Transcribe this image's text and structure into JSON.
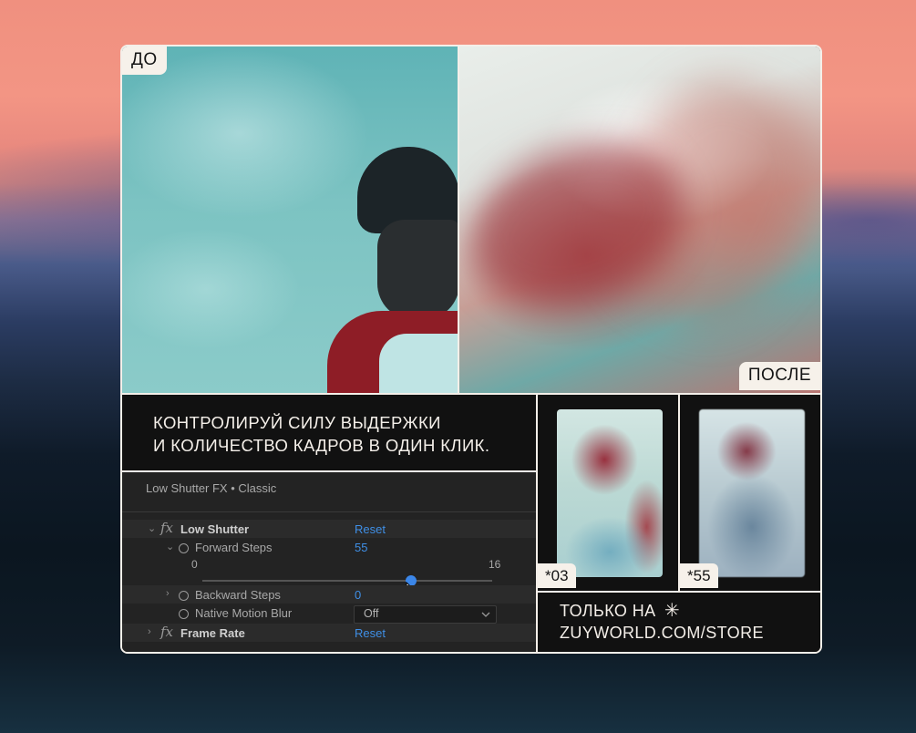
{
  "labels": {
    "before": "ДО",
    "after": "ПОСЛЕ"
  },
  "tagline": {
    "line1": "КОНТРОЛИРУЙ СИЛУ ВЫДЕРЖКИ",
    "line2": "И КОЛИЧЕСТВО КАДРОВ В ОДИН КЛИК."
  },
  "effect_panel": {
    "title": "Low Shutter FX • Classic",
    "low_shutter": {
      "label": "Low Shutter",
      "reset": "Reset"
    },
    "forward_steps": {
      "label": "Forward Steps",
      "value": "55",
      "slider_min": "0",
      "slider_max": "16",
      "slider_fraction": 0.72
    },
    "backward_steps": {
      "label": "Backward Steps",
      "value": "0"
    },
    "native_motion_blur": {
      "label": "Native Motion Blur",
      "selected": "Off"
    },
    "frame_rate": {
      "label": "Frame Rate",
      "reset": "Reset"
    }
  },
  "thumbnails": [
    {
      "badge": "*03"
    },
    {
      "badge": "*55"
    }
  ],
  "store": {
    "line1": "ТОЛЬКО НА",
    "line2": "ZUYWORLD.COM/STORE",
    "icon": "asterisk-icon"
  },
  "colors": {
    "accent_blue": "#3f8fe6",
    "card_border": "#f4efe9",
    "panel_bg": "#232323"
  }
}
